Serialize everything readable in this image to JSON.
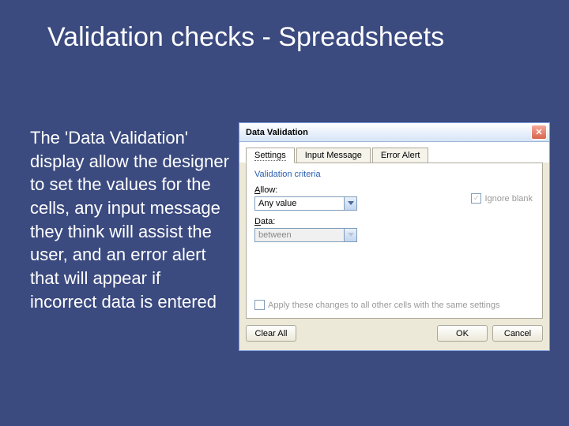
{
  "slide": {
    "title": "Validation checks - Spreadsheets",
    "body": "The 'Data Validation' display allow the designer to set the values for the cells, any input message they think will assist the user, and an error alert that will appear if incorrect data is entered"
  },
  "dialog": {
    "title": "Data Validation",
    "close": "✕",
    "tabs": {
      "settings": "Settings",
      "input_message": "Input Message",
      "error_alert": "Error Alert"
    },
    "criteria_label": "Validation criteria",
    "allow_label": "Allow:",
    "allow_value": "Any value",
    "data_label": "Data:",
    "data_value": "between",
    "ignore_blank": "Ignore blank",
    "apply_changes": "Apply these changes to all other cells with the same settings",
    "buttons": {
      "clear_all": "Clear All",
      "ok": "OK",
      "cancel": "Cancel"
    }
  }
}
